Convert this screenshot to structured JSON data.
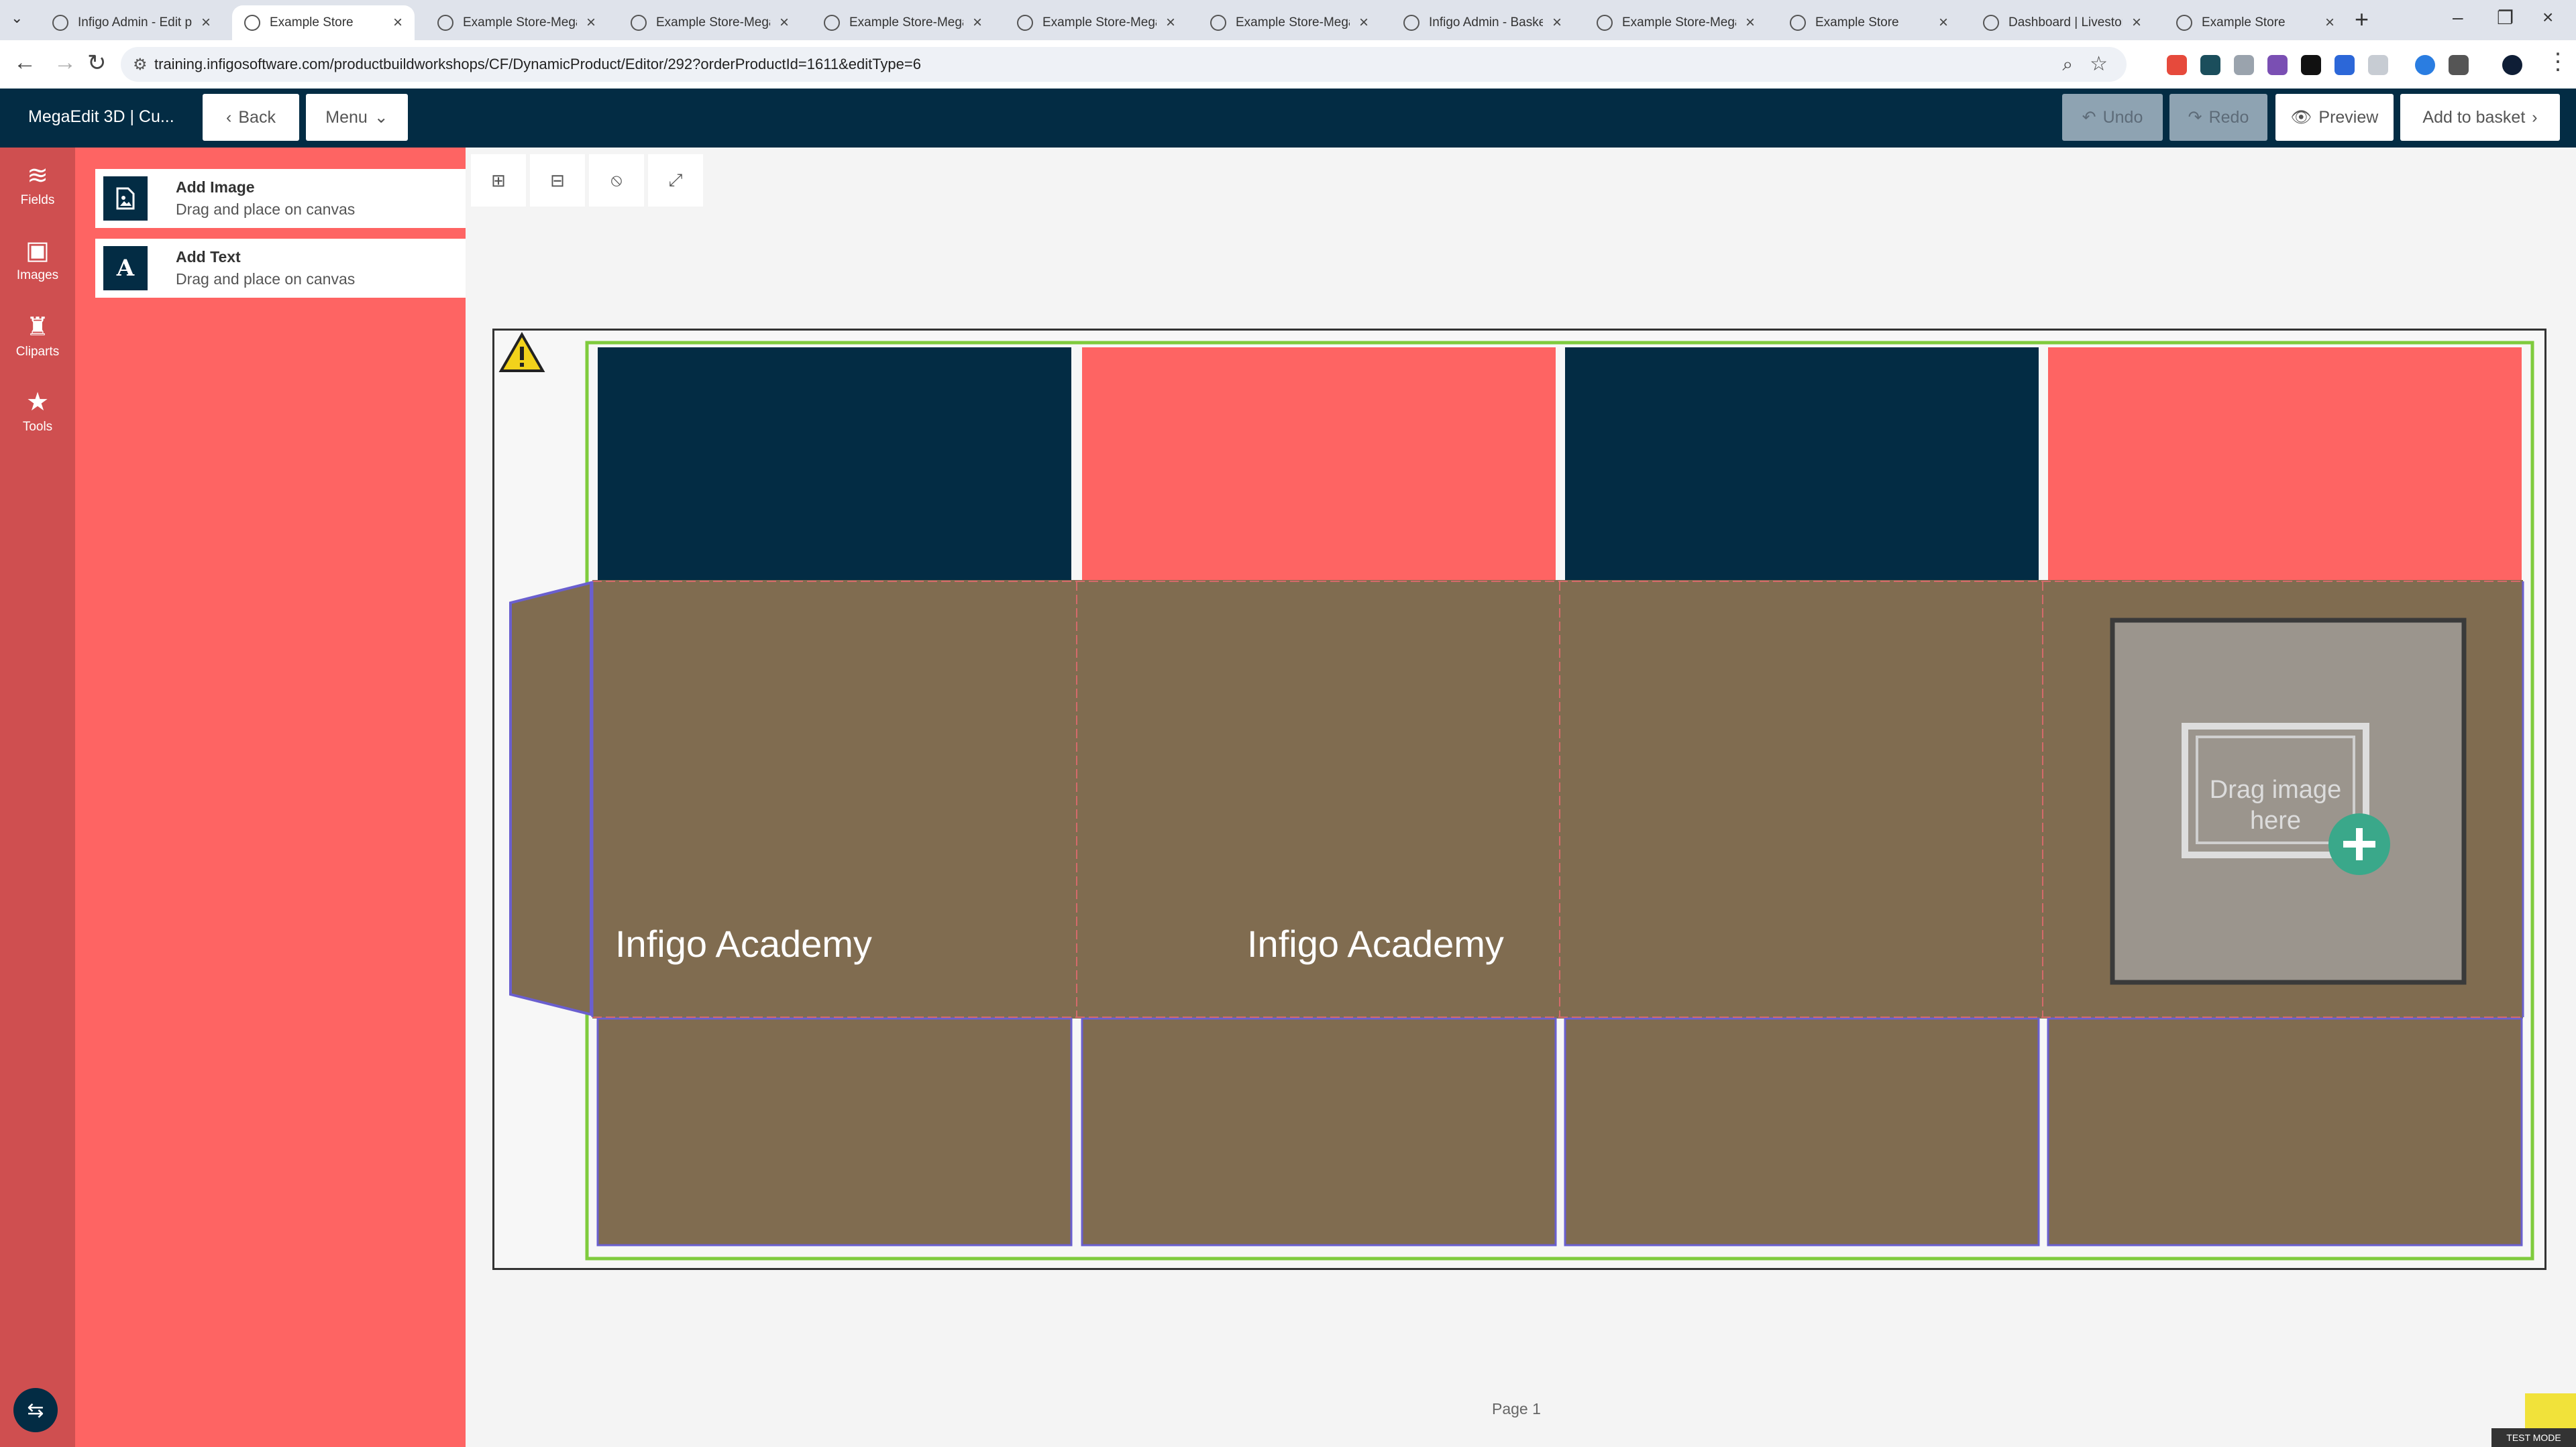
{
  "browser": {
    "tabs": [
      {
        "title": "Infigo Admin - Edit product",
        "active": false
      },
      {
        "title": "Example Store",
        "active": true
      },
      {
        "title": "Example Store-MegaEdit",
        "active": false
      },
      {
        "title": "Example Store-MegaEdit",
        "active": false
      },
      {
        "title": "Example Store-MegaEdit",
        "active": false
      },
      {
        "title": "Example Store-MegaEdit",
        "active": false
      },
      {
        "title": "Example Store-MegaEdit",
        "active": false
      },
      {
        "title": "Infigo Admin - Basket",
        "active": false
      },
      {
        "title": "Example Store-MegaEdit",
        "active": false
      },
      {
        "title": "Example Store",
        "active": false
      },
      {
        "title": "Dashboard | Livestorm",
        "active": false
      },
      {
        "title": "Example Store",
        "active": false
      }
    ],
    "url": "training.infigosoftware.com/productbuildworkshops/CF/DynamicProduct/Editor/292?orderProductId=1611&editType=6"
  },
  "header": {
    "title": "MegaEdit 3D | Cu...",
    "back_label": "Back",
    "menu_label": "Menu",
    "undo_label": "Undo",
    "redo_label": "Redo",
    "preview_label": "Preview",
    "add_to_basket_label": "Add to basket",
    "colors": {
      "header_bg": "#032c44",
      "disabled_btn": "#8ea3b2"
    }
  },
  "leftnav": {
    "items": [
      {
        "label": "Fields",
        "icon": "layers-icon"
      },
      {
        "label": "Images",
        "icon": "images-icon"
      },
      {
        "label": "Cliparts",
        "icon": "chess-piece-icon"
      },
      {
        "label": "Tools",
        "icon": "star-icon"
      }
    ],
    "swap_icon": "swap-arrows-icon"
  },
  "panel": {
    "fields": [
      {
        "title": "Add Image",
        "subtitle": "Drag and place on canvas",
        "icon": "image-file-icon"
      },
      {
        "title": "Add Text",
        "subtitle": "Drag and place on canvas",
        "icon": "text-A-icon"
      }
    ]
  },
  "toolbar": {
    "tools": [
      "zoom-in-icon",
      "zoom-out-icon",
      "reset-icon",
      "fullscreen-icon"
    ]
  },
  "canvas": {
    "text_1": "Infigo Academy",
    "text_2": "Infigo Academy",
    "drop_placeholder": "Drag image here",
    "page_label": "Page 1",
    "test_mode_label": "TEST MODE",
    "colors": {
      "navy": "#032c44",
      "coral": "#fe6463",
      "brown": "#806c50",
      "guide_green": "#7fcb3d",
      "cut_blue": "#6a5fcf",
      "fold_red": "#d46a6a"
    }
  }
}
